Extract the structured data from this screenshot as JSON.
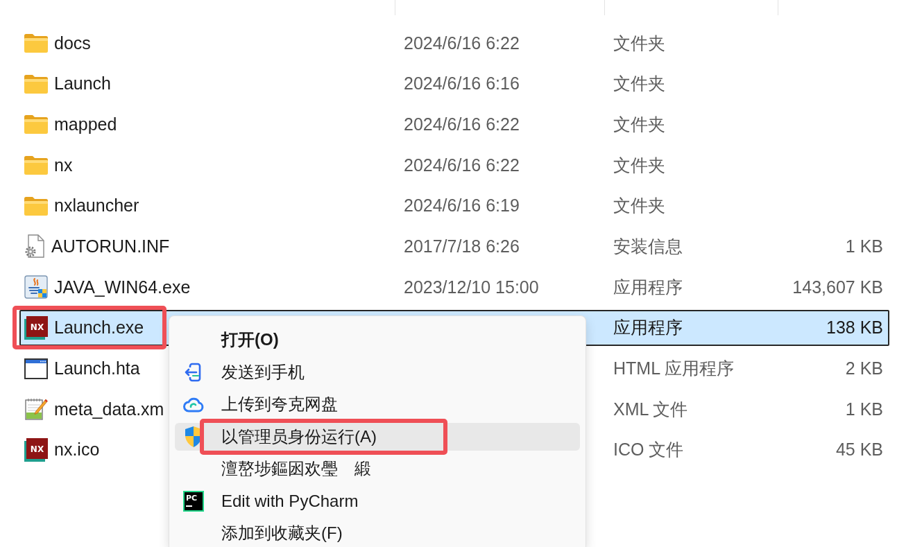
{
  "file_list": {
    "files": [
      {
        "name": "docs",
        "date": "2024/6/16 6:22",
        "type": "文件夹",
        "kind": "folder",
        "selected": false,
        "highlighted": false
      },
      {
        "name": "Launch",
        "date": "2024/6/16 6:16",
        "type": "文件夹",
        "kind": "folder",
        "selected": false,
        "highlighted": false
      },
      {
        "name": "mapped",
        "date": "2024/6/16 6:22",
        "type": "文件夹",
        "kind": "folder",
        "selected": false,
        "highlighted": false
      },
      {
        "name": "nx",
        "date": "2024/6/16 6:22",
        "type": "文件夹",
        "kind": "folder",
        "selected": false,
        "highlighted": false
      },
      {
        "name": "nxlauncher",
        "date": "2024/6/16 6:19",
        "type": "文件夹",
        "kind": "folder",
        "selected": false,
        "highlighted": false
      },
      {
        "name": "AUTORUN.INF",
        "date": "2017/7/18 6:26",
        "type": "安装信息",
        "size": "1 KB",
        "kind": "settings",
        "selected": false,
        "highlighted": false
      },
      {
        "name": "JAVA_WIN64.exe",
        "date": "2023/12/10 15:00",
        "type": "应用程序",
        "size": "143,607 KB",
        "kind": "installer",
        "selected": false,
        "highlighted": false
      },
      {
        "name": "Launch.exe",
        "type": "应用程序",
        "size": "138 KB",
        "kind": "logo",
        "icon_text": "NX",
        "selected": true,
        "highlighted": true
      },
      {
        "name": "Launch.hta",
        "type": "HTML 应用程序",
        "size": "2 KB",
        "kind": "window",
        "selected": false,
        "highlighted": false
      },
      {
        "name": "meta_data.xm",
        "type": "XML 文件",
        "size": "1 KB",
        "kind": "notepad",
        "selected": false,
        "highlighted": false
      },
      {
        "name": "nx.ico",
        "type": "ICO 文件",
        "size": "45 KB",
        "kind": "logo",
        "icon_text": "NX",
        "selected": false,
        "highlighted": false
      }
    ]
  },
  "context_menu": {
    "items": [
      {
        "label": "打开(O)",
        "kind": "plain",
        "default": true,
        "hovered": false,
        "highlighted": false
      },
      {
        "label": "发送到手机",
        "kind": "phone",
        "default": false,
        "hovered": false,
        "highlighted": false
      },
      {
        "label": "上传到夸克网盘",
        "kind": "cloud",
        "default": false,
        "hovered": false,
        "highlighted": false
      },
      {
        "label": "以管理员身份运行(A)",
        "kind": "shield",
        "default": false,
        "hovered": true,
        "highlighted": true
      },
      {
        "label": "澶嶅埗鏂囦欢璺　緞",
        "kind": "plain",
        "default": false,
        "hovered": false,
        "highlighted": false
      },
      {
        "label": "Edit with PyCharm",
        "kind": "logo",
        "icon_text": "PC",
        "default": false,
        "hovered": false,
        "highlighted": false
      },
      {
        "label": "添加到收藏夹(F)",
        "kind": "plain",
        "default": false,
        "hovered": false,
        "highlighted": false
      }
    ]
  }
}
